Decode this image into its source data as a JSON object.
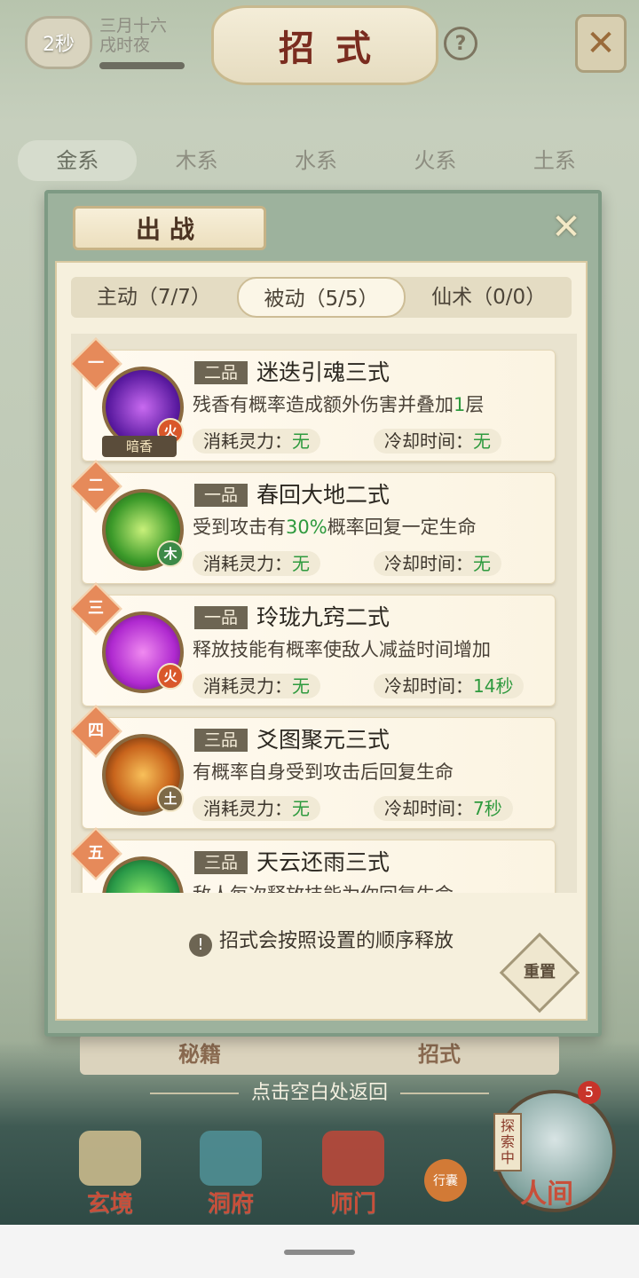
{
  "header": {
    "timer": "2秒",
    "date_line1": "三月十六",
    "date_line2": "戌时夜",
    "title": "招式",
    "help": "?"
  },
  "element_tabs": [
    "金系",
    "木系",
    "水系",
    "火系",
    "土系"
  ],
  "background_sub_tabs": [
    "秘籍",
    "招式"
  ],
  "back_hint": "点击空白处返回",
  "bottom_nav": [
    {
      "label": "玄境"
    },
    {
      "label": "洞府"
    },
    {
      "label": "师门"
    },
    {
      "label": "行囊"
    }
  ],
  "explore": {
    "tag": "探索中",
    "badge": "5",
    "label": "人间"
  },
  "modal": {
    "title": "出战",
    "tabs": [
      {
        "label": "主动（7/7）",
        "active": false
      },
      {
        "label": "被动（5/5）",
        "active": true
      },
      {
        "label": "仙术（0/0）",
        "active": false
      }
    ],
    "stat_labels": {
      "cost": "消耗灵力：",
      "cooldown": "冷却时间："
    },
    "skills": [
      {
        "order": "一",
        "grade": "二品",
        "name": "迷迭引魂三式",
        "desc_pre": "残香有概率造成额外伤害并叠加",
        "desc_hl": "1",
        "desc_post": "层",
        "cost": "无",
        "cooldown": "无",
        "element": "火",
        "tag": "暗香",
        "icon_color": "#7a2ad0"
      },
      {
        "order": "二",
        "grade": "一品",
        "name": "春回大地二式",
        "desc_pre": "受到攻击有",
        "desc_hl": "30%",
        "desc_post": "概率回复一定生命",
        "cost": "无",
        "cooldown": "无",
        "element": "木",
        "tag": "",
        "icon_color": "#4aa832"
      },
      {
        "order": "三",
        "grade": "一品",
        "name": "玲珑九窍二式",
        "desc_pre": "释放技能有概率使敌人减益时间增加",
        "desc_hl": "",
        "desc_post": "",
        "cost": "无",
        "cooldown": "14秒",
        "element": "火",
        "tag": "",
        "icon_color": "#c02ad8"
      },
      {
        "order": "四",
        "grade": "三品",
        "name": "爻图聚元三式",
        "desc_pre": "有概率自身受到攻击后回复生命",
        "desc_hl": "",
        "desc_post": "",
        "cost": "无",
        "cooldown": "7秒",
        "element": "土",
        "tag": "",
        "icon_color": "#c8641c"
      },
      {
        "order": "五",
        "grade": "三品",
        "name": "天云还雨三式",
        "desc_pre": "敌人每次释放技能为你回复生命",
        "desc_hl": "",
        "desc_post": "",
        "cost": "",
        "cooldown": "",
        "element": "",
        "tag": "",
        "icon_color": "#2a9a48"
      }
    ],
    "notice": "招式会按照设置的顺序释放",
    "reset": "重置"
  },
  "colors": {
    "fire": "#d9572a",
    "wood": "#3d8a48",
    "earth": "#7d6a48",
    "highlight": "#2e9a3e"
  }
}
